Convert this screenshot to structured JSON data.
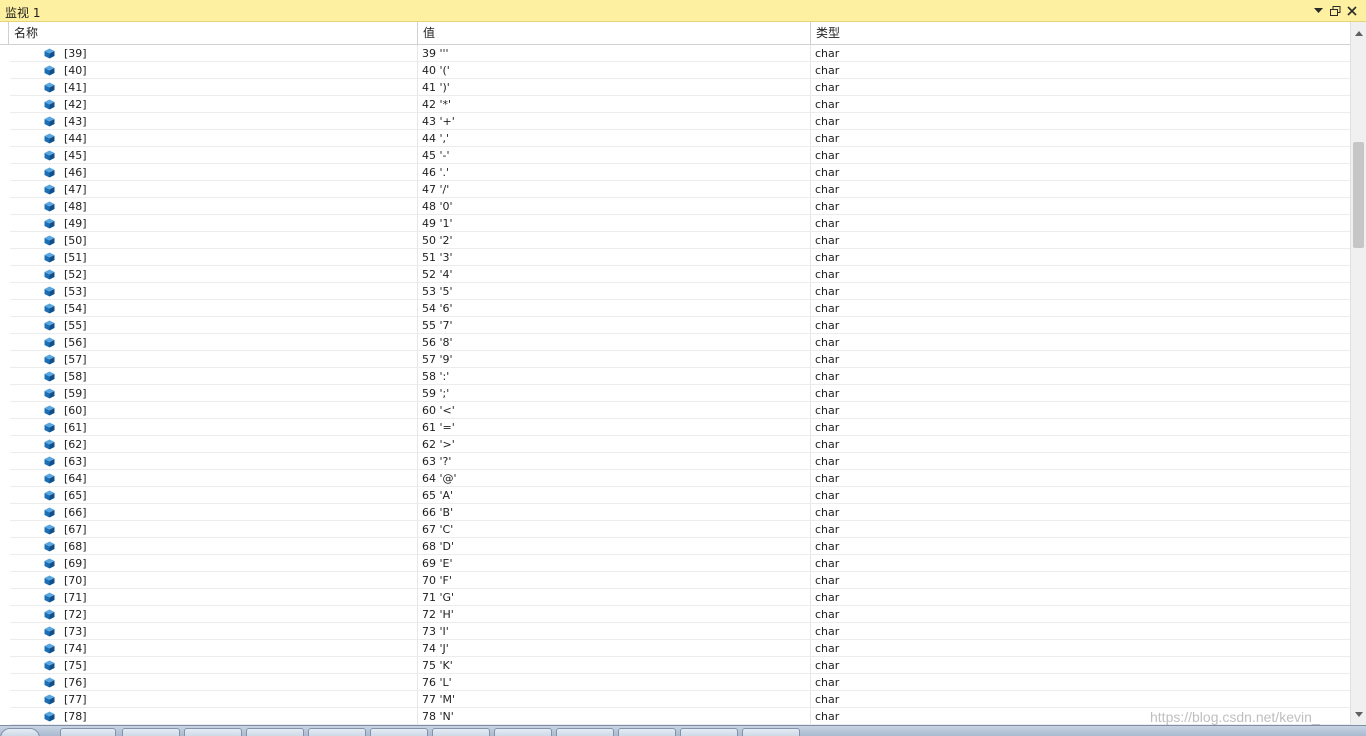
{
  "window": {
    "title": "监视 1",
    "buttons": [
      "dropdown-icon",
      "restore-icon",
      "close-icon"
    ]
  },
  "columns": {
    "name": "名称",
    "value": "值",
    "type": "类型"
  },
  "rows": [
    {
      "name": "[39]",
      "value": "39 '''",
      "type": "char"
    },
    {
      "name": "[40]",
      "value": "40 '('",
      "type": "char"
    },
    {
      "name": "[41]",
      "value": "41 ')'",
      "type": "char"
    },
    {
      "name": "[42]",
      "value": "42 '*'",
      "type": "char"
    },
    {
      "name": "[43]",
      "value": "43 '+'",
      "type": "char"
    },
    {
      "name": "[44]",
      "value": "44 ','",
      "type": "char"
    },
    {
      "name": "[45]",
      "value": "45 '-'",
      "type": "char"
    },
    {
      "name": "[46]",
      "value": "46 '.'",
      "type": "char"
    },
    {
      "name": "[47]",
      "value": "47 '/'",
      "type": "char"
    },
    {
      "name": "[48]",
      "value": "48 '0'",
      "type": "char"
    },
    {
      "name": "[49]",
      "value": "49 '1'",
      "type": "char"
    },
    {
      "name": "[50]",
      "value": "50 '2'",
      "type": "char"
    },
    {
      "name": "[51]",
      "value": "51 '3'",
      "type": "char"
    },
    {
      "name": "[52]",
      "value": "52 '4'",
      "type": "char"
    },
    {
      "name": "[53]",
      "value": "53 '5'",
      "type": "char"
    },
    {
      "name": "[54]",
      "value": "54 '6'",
      "type": "char"
    },
    {
      "name": "[55]",
      "value": "55 '7'",
      "type": "char"
    },
    {
      "name": "[56]",
      "value": "56 '8'",
      "type": "char"
    },
    {
      "name": "[57]",
      "value": "57 '9'",
      "type": "char"
    },
    {
      "name": "[58]",
      "value": "58 ':'",
      "type": "char"
    },
    {
      "name": "[59]",
      "value": "59 ';'",
      "type": "char"
    },
    {
      "name": "[60]",
      "value": "60 '<'",
      "type": "char"
    },
    {
      "name": "[61]",
      "value": "61 '='",
      "type": "char"
    },
    {
      "name": "[62]",
      "value": "62 '>'",
      "type": "char"
    },
    {
      "name": "[63]",
      "value": "63 '?'",
      "type": "char"
    },
    {
      "name": "[64]",
      "value": "64 '@'",
      "type": "char"
    },
    {
      "name": "[65]",
      "value": "65 'A'",
      "type": "char"
    },
    {
      "name": "[66]",
      "value": "66 'B'",
      "type": "char"
    },
    {
      "name": "[67]",
      "value": "67 'C'",
      "type": "char"
    },
    {
      "name": "[68]",
      "value": "68 'D'",
      "type": "char"
    },
    {
      "name": "[69]",
      "value": "69 'E'",
      "type": "char"
    },
    {
      "name": "[70]",
      "value": "70 'F'",
      "type": "char"
    },
    {
      "name": "[71]",
      "value": "71 'G'",
      "type": "char"
    },
    {
      "name": "[72]",
      "value": "72 'H'",
      "type": "char"
    },
    {
      "name": "[73]",
      "value": "73 'I'",
      "type": "char"
    },
    {
      "name": "[74]",
      "value": "74 'J'",
      "type": "char"
    },
    {
      "name": "[75]",
      "value": "75 'K'",
      "type": "char"
    },
    {
      "name": "[76]",
      "value": "76 'L'",
      "type": "char"
    },
    {
      "name": "[77]",
      "value": "77 'M'",
      "type": "char"
    },
    {
      "name": "[78]",
      "value": "78 'N'",
      "type": "char"
    }
  ],
  "row_icon": "member-cube-icon",
  "watermark": "https://blog.csdn.net/kevin_",
  "colors": {
    "title_bar": "#fdf0a0",
    "icon": "#1c6fb5"
  }
}
